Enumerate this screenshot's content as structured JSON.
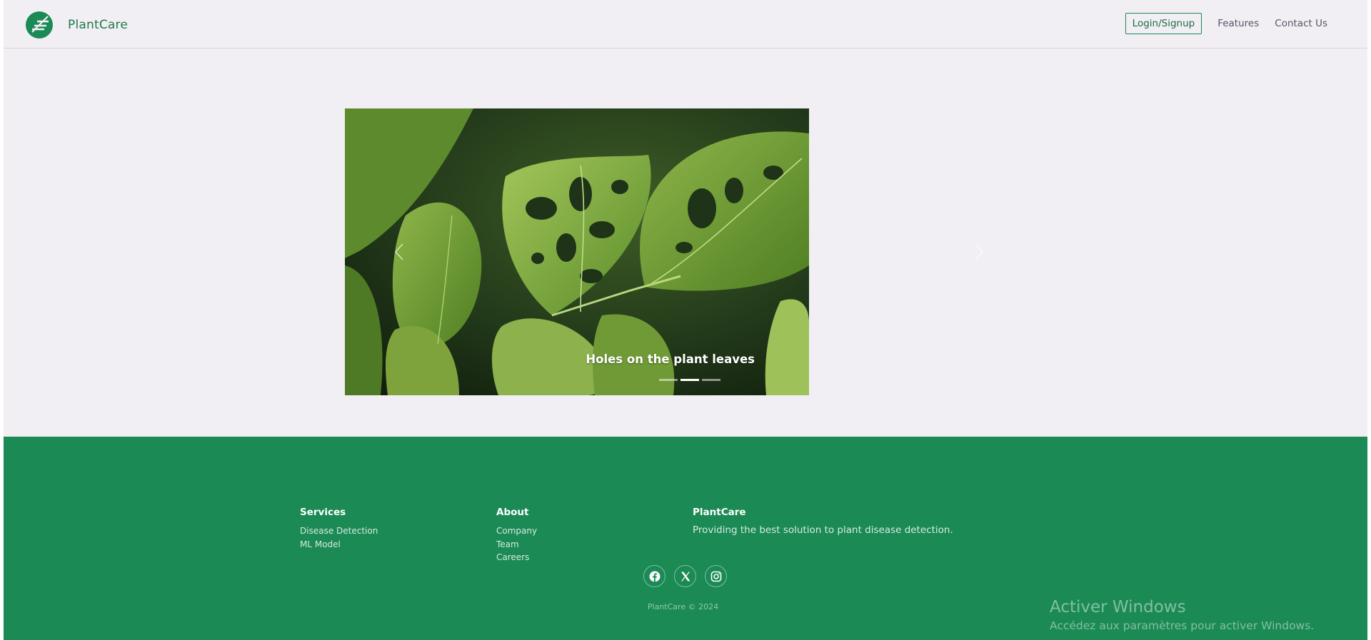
{
  "brand": {
    "name": "PlantCare"
  },
  "nav": {
    "login": "Login/Signup",
    "features": "Features",
    "contact": "Contact Us"
  },
  "carousel": {
    "caption": "Holes on the plant leaves",
    "slide_count": 3,
    "active_index": 1
  },
  "footer": {
    "services": {
      "title": "Services",
      "links": [
        "Disease Detection",
        "ML Model"
      ]
    },
    "about": {
      "title": "About",
      "links": [
        "Company",
        "Team",
        "Careers"
      ]
    },
    "plantcare": {
      "title": "PlantCare",
      "description": "Providing the best solution to plant disease detection."
    },
    "social_icons": [
      "facebook-icon",
      "x-icon",
      "instagram-icon"
    ],
    "copyright": "PlantCare © 2024"
  },
  "watermark": {
    "title": "Activer Windows",
    "subtitle": "Accédez aux paramètres pour activer Windows."
  },
  "colors": {
    "brand_green": "#1b8a55",
    "page_bg": "#f2eff4"
  }
}
